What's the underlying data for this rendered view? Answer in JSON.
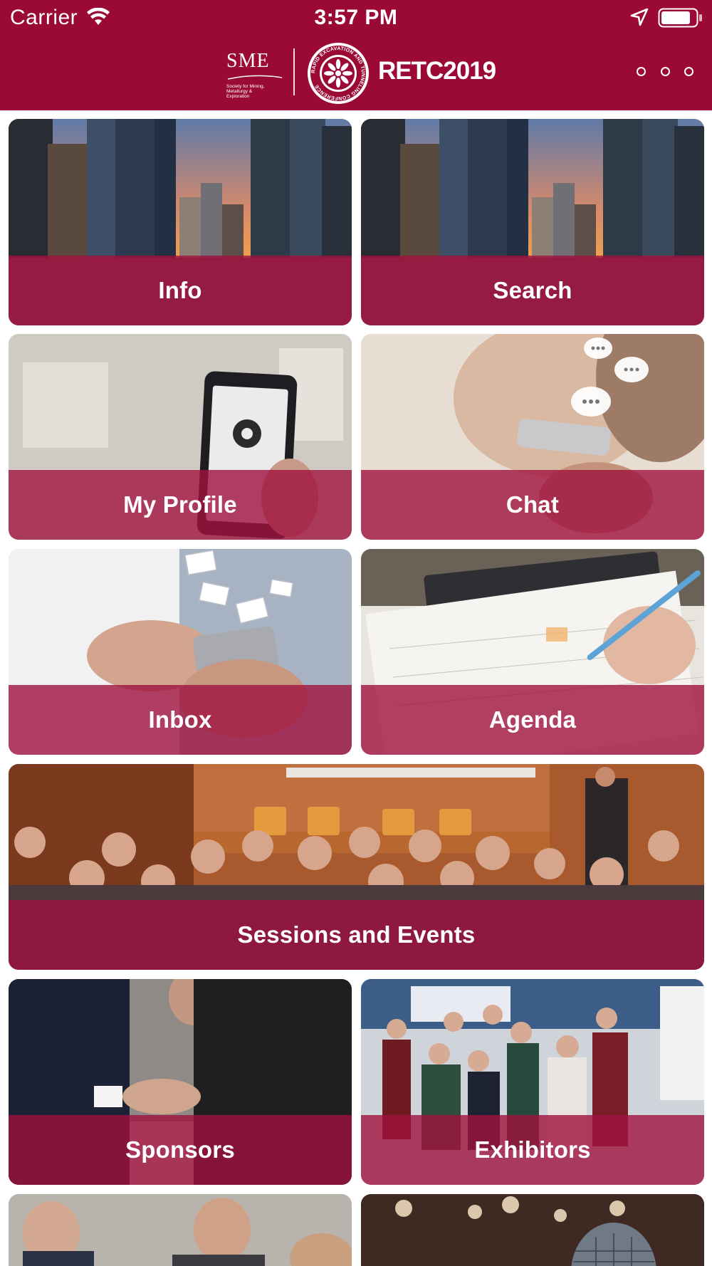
{
  "status_bar": {
    "carrier": "Carrier",
    "time": "3:57 PM"
  },
  "header": {
    "sme_logo_text": "SME",
    "sme_logo_subtext": "Society for Mining, Metallurgy & Exploration",
    "emblem_text": "RAPID EXCAVATION AND TUNNELING CONFERENCE",
    "title": "RETC2019",
    "more_icon": "ellipsis-icon"
  },
  "colors": {
    "brand": "#9b0a36",
    "overlay": "#a0123e"
  },
  "tiles": [
    {
      "label": "Info",
      "icon": "city-skyline-photo"
    },
    {
      "label": "Search",
      "icon": "city-skyline-photo"
    },
    {
      "label": "My Profile",
      "icon": "phone-settings-photo"
    },
    {
      "label": "Chat",
      "icon": "phone-chat-photo"
    },
    {
      "label": "Inbox",
      "icon": "phone-mail-photo"
    },
    {
      "label": "Agenda",
      "icon": "calendar-pencil-photo"
    },
    {
      "label": "Sessions and Events",
      "icon": "conference-audience-photo"
    },
    {
      "label": "Sponsors",
      "icon": "handshake-photo"
    },
    {
      "label": "Exhibitors",
      "icon": "exhibition-crowd-photo"
    }
  ]
}
